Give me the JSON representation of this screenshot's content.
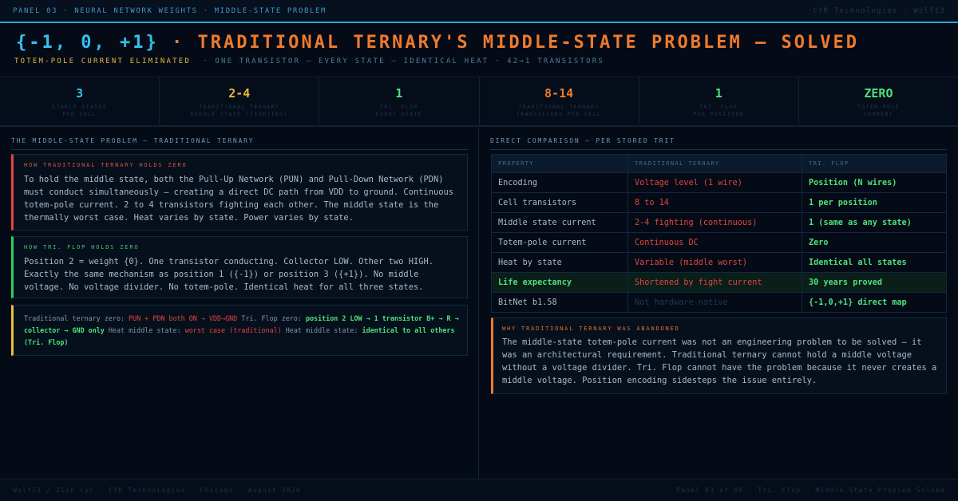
{
  "topbar": {
    "left": "PANEL 03 · NEURAL NETWORK WEIGHTS · MIDDLE-STATE PROBLEM",
    "right": "CYR Technologies · Wolf13"
  },
  "header": {
    "title_set": "{-1, 0, +1}",
    "title_dot": "·",
    "title_rest": "TRADITIONAL TERNARY'S MIDDLE-STATE PROBLEM — SOLVED",
    "subtitle_accent": "TOTEM-POLE CURRENT ELIMINATED",
    "subtitle_rest": "·  ONE TRANSISTOR — EVERY STATE — IDENTICAL HEAT  ·  42→1 TRANSISTORS"
  },
  "stats": [
    {
      "value": "3",
      "line1": "STABLE STATES",
      "line2": "PER CELL",
      "color": "#35c0ea"
    },
    {
      "value": "2-4",
      "line1": "TRADITIONAL TERNARY",
      "line2": "MIDDLE STATE (FIGHTING)",
      "color": "#e6b93a"
    },
    {
      "value": "1",
      "line1": "TRI. FLOP",
      "line2": "EVERY STATE",
      "color": "#4ee27a"
    },
    {
      "value": "8-14",
      "line1": "TRADITIONAL TERNARY",
      "line2": "TRANSISTORS PER CELL",
      "color": "#f07a2c"
    },
    {
      "value": "1",
      "line1": "TRI. FLOP",
      "line2": "PER POSITION",
      "color": "#4ee27a"
    },
    {
      "value": "ZERO",
      "line1": "TOTEM-POLE",
      "line2": "CURRENT",
      "color": "#4ee27a"
    }
  ],
  "left": {
    "section_title": "THE MIDDLE-STATE PROBLEM — TRADITIONAL TERNARY",
    "box1": {
      "title": "HOW TRADITIONAL TERNARY HOLDS ZERO",
      "text": "To hold the middle state, both the Pull-Up Network (PUN) and Pull-Down Network (PDN) must conduct simultaneously — creating a direct DC path from VDD to ground. Continuous totem-pole current. 2 to 4 transistors fighting each other. The middle state is the thermally worst case. Heat varies by state. Power varies by state."
    },
    "box2": {
      "title": "HOW TRI. FLOP HOLDS ZERO",
      "text": "Position 2 = weight {0}. One transistor conducting. Collector LOW. Other two HIGH. Exactly the same mechanism as position 1 ({-1}) or position 3 ({+1}). No middle voltage. No voltage divider. No totem-pole. Identical heat for all three states."
    },
    "box3": {
      "s1": "Traditional ternary zero: ",
      "s2": "PUN + PDN both ON → VDD→GND",
      "s3": " Tri. Flop zero: ",
      "s4": "position 2 LOW → 1 transistor B+ → R → collector → GND only",
      "s5": " Heat middle state: ",
      "s6": "worst case (traditional)",
      "s7": " Heat middle state: ",
      "s8": "identical to all others (Tri. Flop)"
    }
  },
  "right": {
    "section_title": "DIRECT COMPARISON — PER STORED TRIT",
    "headers": [
      "PROPERTY",
      "TRADITIONAL TERNARY",
      "TRI. FLOP"
    ],
    "rows": [
      {
        "property": "Encoding",
        "traditional": "Voltage level (1 wire)",
        "triflop": "Position (N wires)"
      },
      {
        "property": "Cell transistors",
        "traditional": "8 to 14",
        "triflop": "1 per position"
      },
      {
        "property": "Middle state current",
        "traditional": "2-4 fighting (continuous)",
        "triflop": "1 (same as any state)"
      },
      {
        "property": "Totem-pole current",
        "traditional": "Continuous DC",
        "triflop": "Zero"
      },
      {
        "property": "Heat by state",
        "traditional": "Variable (middle worst)",
        "triflop": "Identical all states"
      },
      {
        "property": "Life expectancy",
        "traditional": "Shortened by fight current",
        "triflop": "30 years proved"
      },
      {
        "property": "BitNet b1.58",
        "traditional": "Not hardware-native",
        "triflop": "{-1,0,+1} direct map"
      }
    ],
    "why": {
      "title": "WHY TRADITIONAL TERNARY WAS ABANDONED",
      "text": "The middle-state totem-pole current was not an engineering problem to be solved — it was an architectural requirement. Traditional ternary cannot hold a middle voltage without a voltage divider. Tri. Flop cannot have the problem because it never creates a middle voltage. Position encoding sidesteps the issue entirely."
    }
  },
  "footer": {
    "left": "Wolf13 / Zion Cyr · CYR Technologies · Chicago · August 2026",
    "right": "Panel 03 of 06 · Tri. Flop · Middle-State Problem Solved"
  }
}
